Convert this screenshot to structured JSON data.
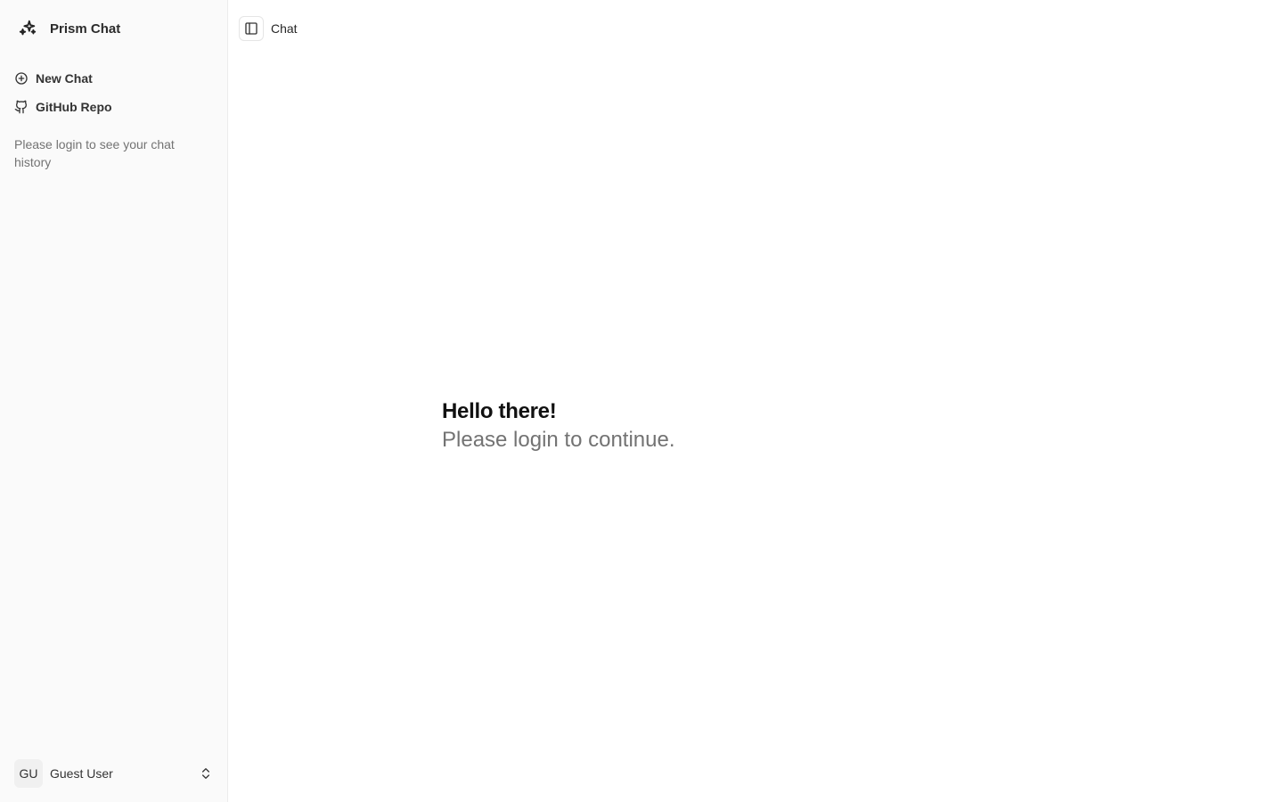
{
  "sidebar": {
    "brand": {
      "name": "Prism Chat",
      "icon": "sparkles-icon"
    },
    "items": [
      {
        "label": "New Chat",
        "icon": "plus-circle-icon"
      },
      {
        "label": "GitHub Repo",
        "icon": "github-icon"
      }
    ],
    "history_note": "Please login to see your chat history",
    "user": {
      "initials": "GU",
      "name": "Guest User",
      "menu_icon": "chevrons-up-down-icon"
    }
  },
  "header": {
    "toggle_icon": "sidebar-toggle-icon",
    "title": "Chat"
  },
  "main": {
    "greeting_title": "Hello there!",
    "greeting_subtitle": "Please login to continue."
  },
  "colors": {
    "sidebar_bg": "#fafafa",
    "text_primary": "#111111",
    "text_muted": "#737373",
    "border": "#e5e5e5"
  }
}
